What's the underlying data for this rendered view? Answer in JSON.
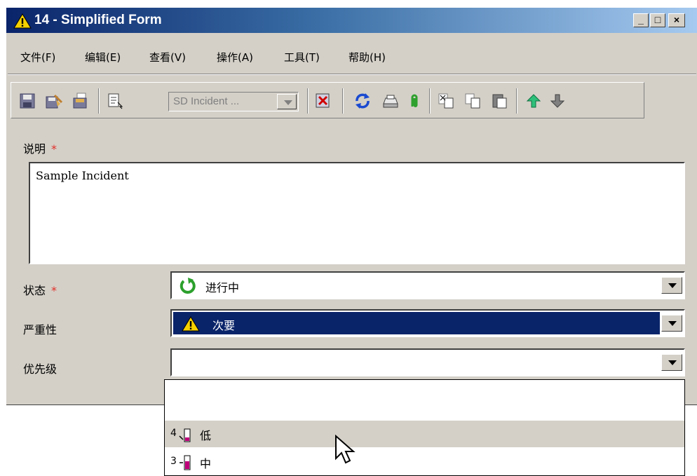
{
  "window": {
    "title": "14 - Simplified Form",
    "controls": {
      "minimize": "_",
      "maximize": "□",
      "close": "×"
    }
  },
  "menu": [
    "文件(F)",
    "编辑(E)",
    "查看(V)",
    "操作(A)",
    "工具(T)",
    "帮助(H)"
  ],
  "toolbar": {
    "template_combo": "SD Incident ..."
  },
  "form": {
    "description": {
      "label": "说明",
      "required_mark": "*",
      "value": "Sample Incident"
    },
    "status": {
      "label": "状态",
      "required_mark": "*",
      "value": "进行中",
      "icon": "refresh-green-icon"
    },
    "severity": {
      "label": "严重性",
      "value": "次要",
      "icon": "warning-icon"
    },
    "priority": {
      "label": "优先级",
      "value": ""
    }
  },
  "priority_dropdown": {
    "options": [
      {
        "num": "",
        "label": ""
      },
      {
        "num": "4",
        "label": "低"
      },
      {
        "num": "3",
        "label": "中"
      }
    ],
    "hovered_index": 1
  },
  "colors": {
    "selection": "#0a246a",
    "required": "#e0302a",
    "face": "#d4d0c8",
    "priority_bar": "#c0007a"
  }
}
